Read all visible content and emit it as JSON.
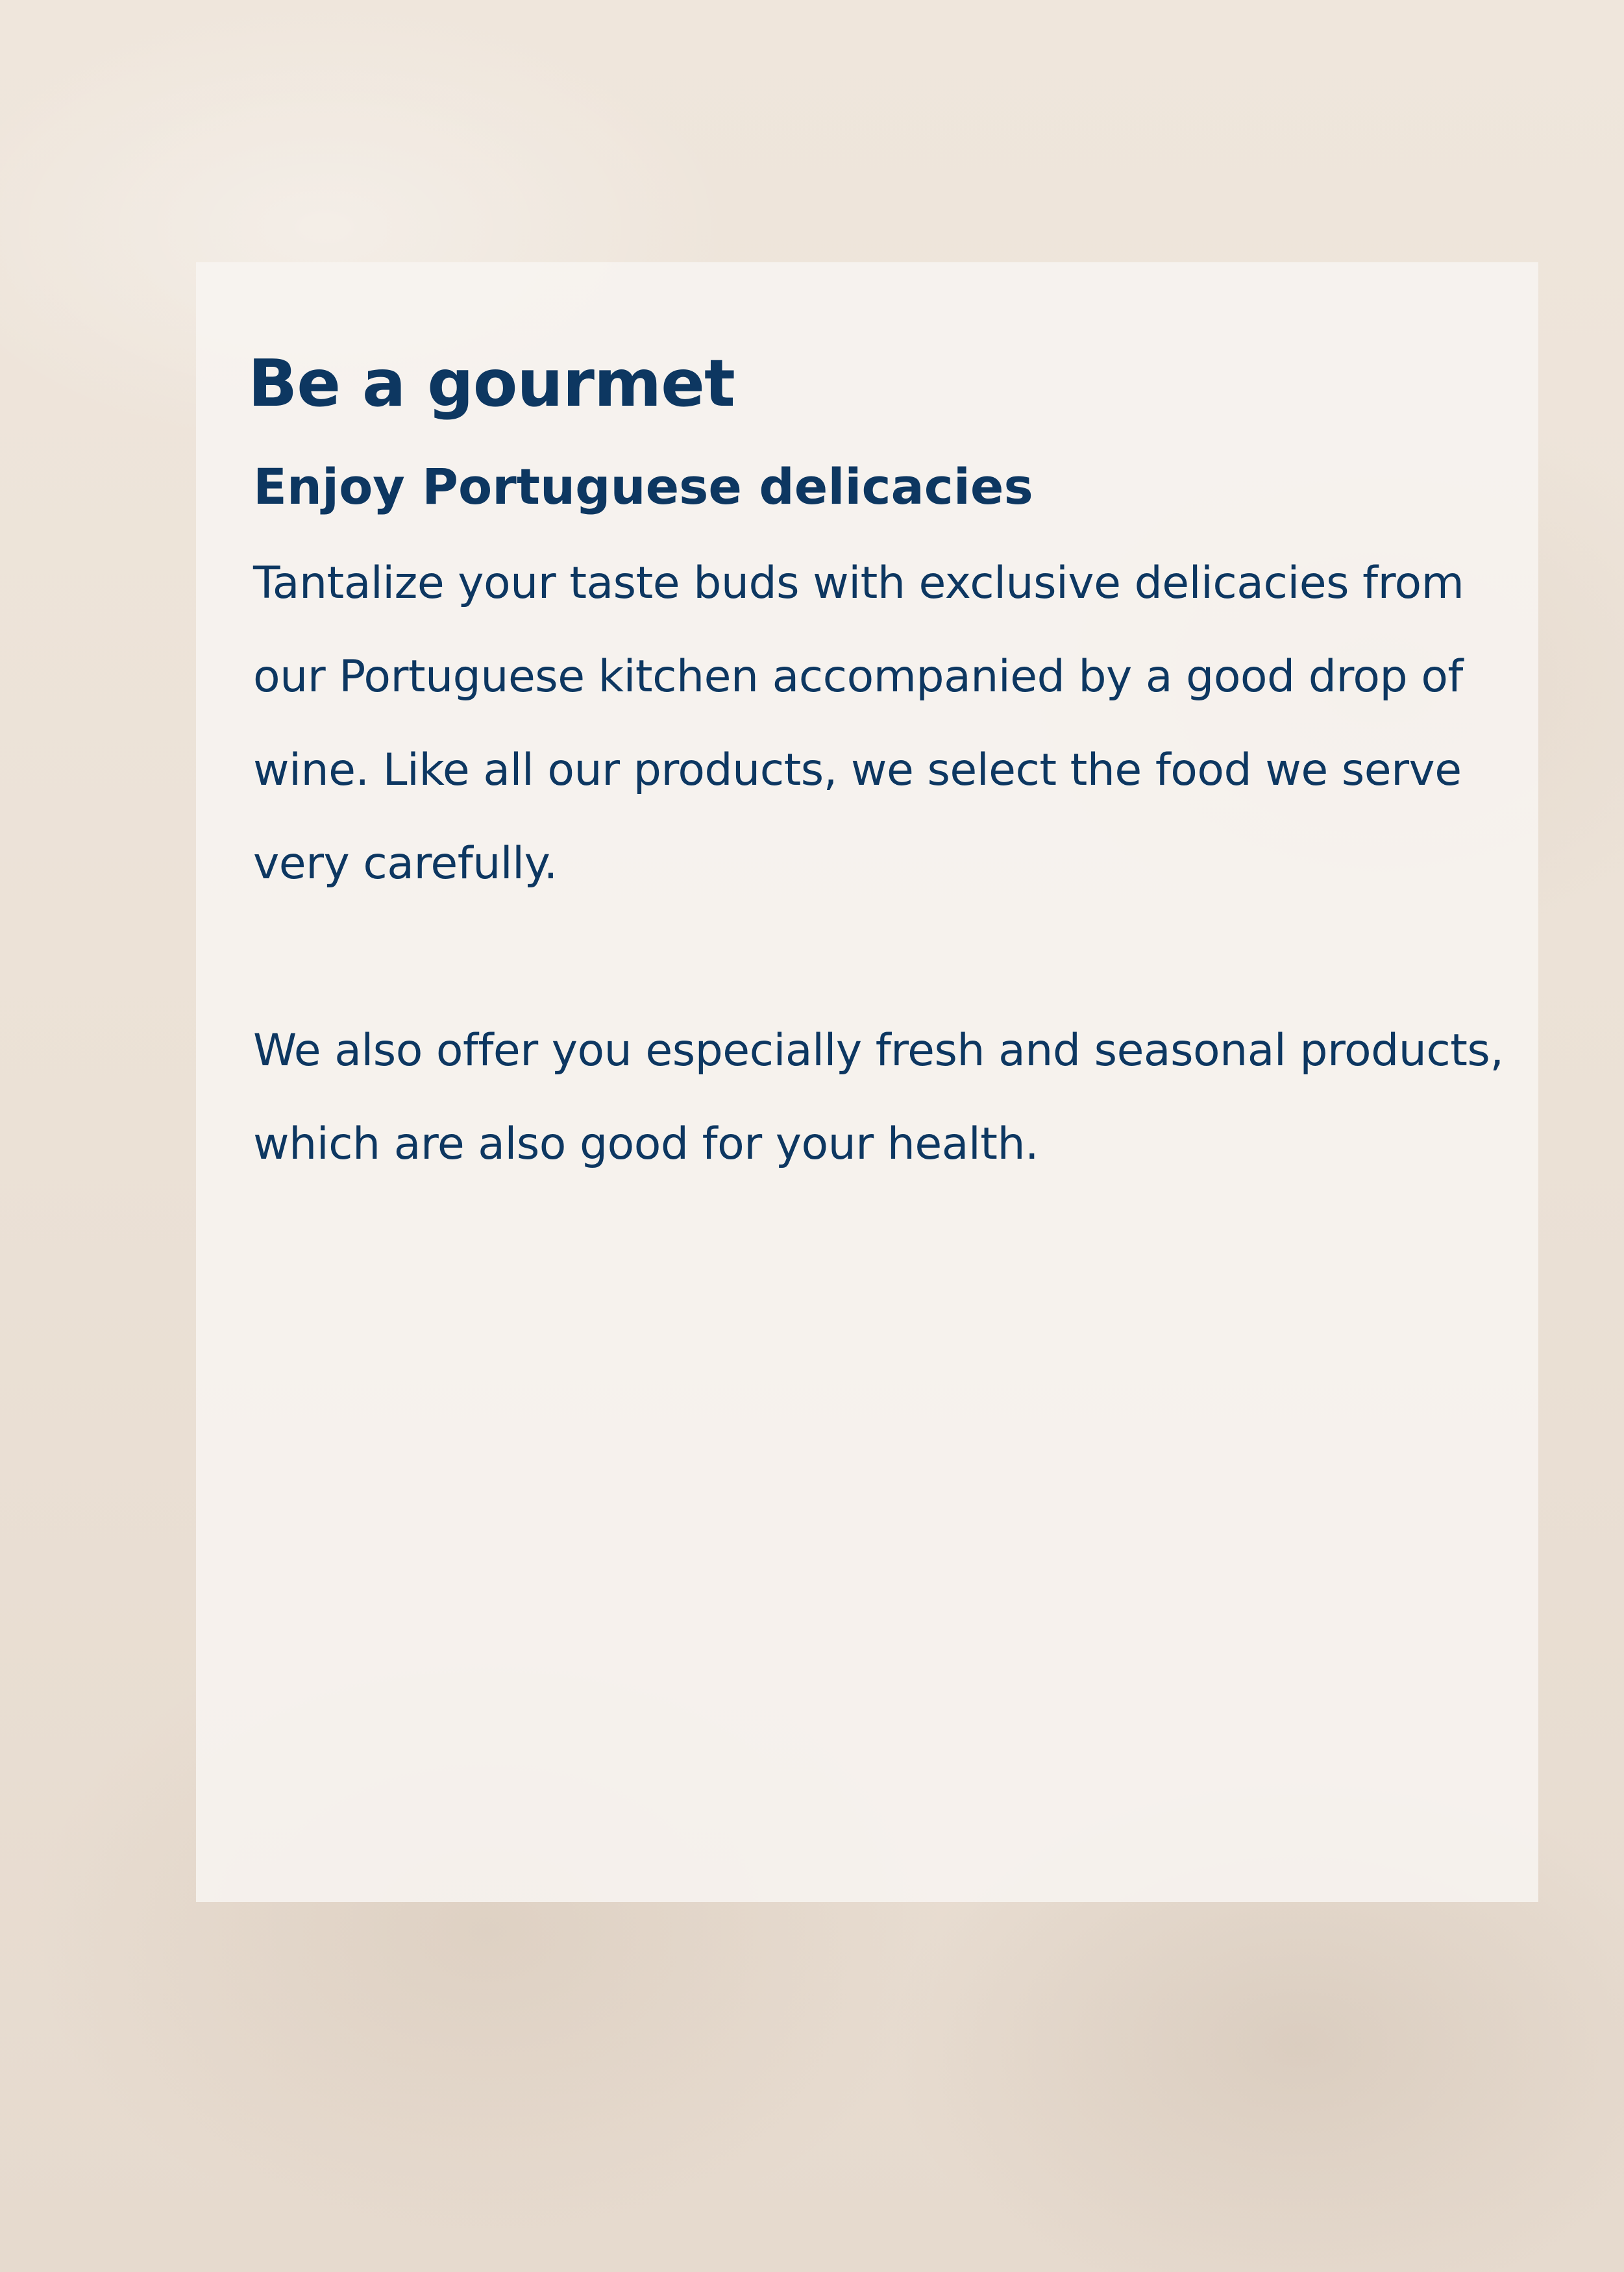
{
  "card": {
    "title": "Be a gourmet",
    "subtitle": "Enjoy Portuguese delicacies",
    "paragraphs": [
      "Tantalize your taste buds with exclusive delicacies from our Portuguese kitchen accompanied by a good drop of wine. Like all our products, we select the food we serve very carefully.",
      "We also offer you especially fresh and seasonal products, which are also good for your health."
    ]
  },
  "colors": {
    "text": "#0d3761",
    "card_background": "#f7f4f0",
    "page_background": "#ebe1d6"
  }
}
